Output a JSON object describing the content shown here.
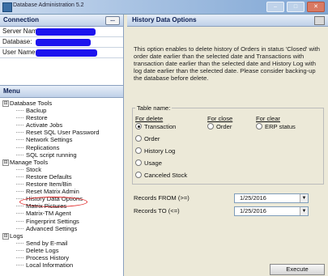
{
  "window": {
    "title": "Database Administration 5.2",
    "icon": "app-icon"
  },
  "connection": {
    "header": "Connection",
    "button_label": "...",
    "fields": [
      {
        "label": "Server Name:"
      },
      {
        "label": "Database:"
      },
      {
        "label": "User Name"
      }
    ]
  },
  "menu": {
    "header": "Menu",
    "groups": [
      {
        "label": "Database Tools",
        "expander": "⊟",
        "items": [
          "Backup",
          "Restore",
          "Activate Jobs",
          "Reset SQL User Password",
          "Network Settings",
          "Replications",
          "SQL script running"
        ]
      },
      {
        "label": "Manage Tools",
        "expander": "⊟",
        "items": [
          "Stock",
          "Restore Defaults",
          "Restore Item/Bin",
          "Reset Matrix Admin",
          "History Data Options",
          "Matrix Pictures",
          "Matrix-TM Agent",
          "Fingerprint Settings",
          "Advanced Settings"
        ]
      },
      {
        "label": "Logs",
        "expander": "⊟",
        "items": [
          "Send by E-mail",
          "Delete Logs",
          "Process History",
          "Local Information"
        ]
      }
    ]
  },
  "history": {
    "header": "History Data Options",
    "description": "This option enables to delete history of Orders in status 'Closed' with order date earlier than the selected date and Transactions with transaction date earlier than the selected date and History Log with log date earlier than the selected date.  Please consider backing-up the database before delete.",
    "table_name_label": "Table name:",
    "col_delete": "For delete",
    "col_close": "For close",
    "col_clear": "For clear",
    "delete_options": [
      "Transaction",
      "Order",
      "History Log",
      "Usage",
      "Canceled Stock"
    ],
    "close_options": [
      "Order"
    ],
    "clear_options": [
      "ERP status"
    ],
    "records_from_label": "Records FROM (>=)",
    "records_from_value": "1/25/2016",
    "records_to_label": "Records TO (<=)",
    "records_to_value": "1/25/2016",
    "execute_label": "Execute"
  }
}
